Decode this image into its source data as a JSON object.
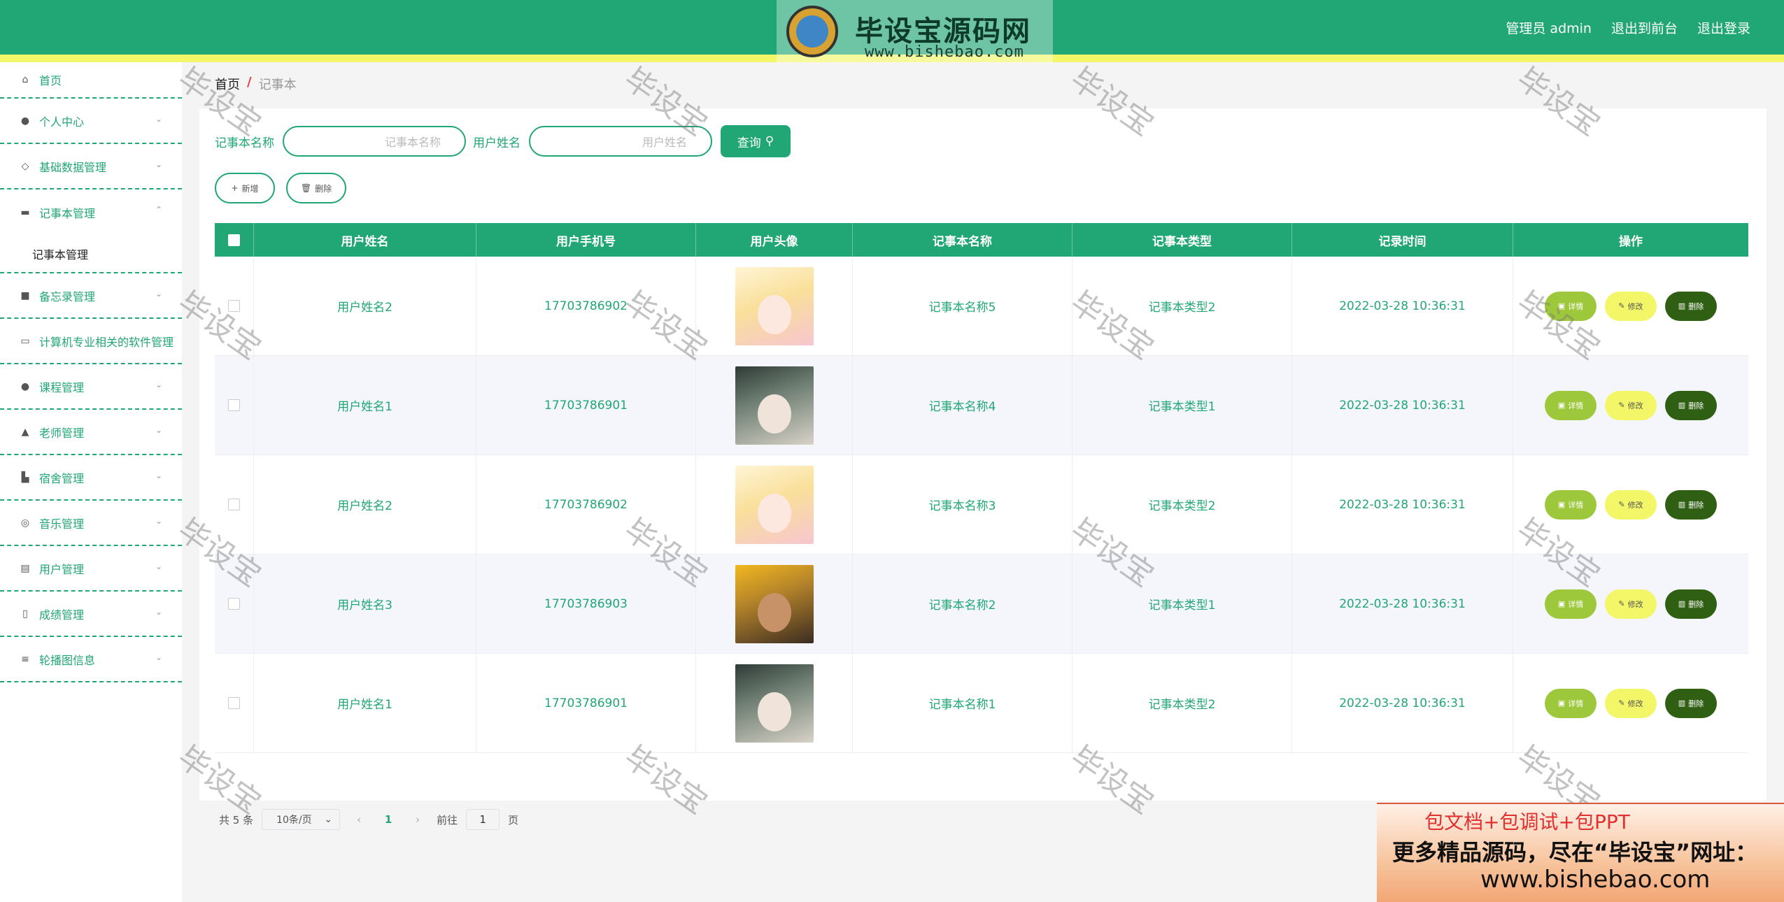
{
  "header": {
    "logo_brand": "毕设宝源码网",
    "logo_url": "www.bishebao.com",
    "admin_label": "管理员 admin",
    "front_label": "退出到前台",
    "logout_label": "退出登录"
  },
  "sidebar": {
    "items": [
      {
        "label": "首页",
        "icon": "home-icon"
      },
      {
        "label": "个人中心",
        "icon": "user-icon"
      },
      {
        "label": "基础数据管理",
        "icon": "bell-off-icon"
      },
      {
        "label": "记事本管理",
        "icon": "monitor-icon"
      },
      {
        "label": "备忘录管理",
        "icon": "check-square-icon"
      },
      {
        "label": "计算机专业相关的软件管理",
        "icon": "chat-icon"
      },
      {
        "label": "课程管理",
        "icon": "user-icon"
      },
      {
        "label": "老师管理",
        "icon": "teacher-icon"
      },
      {
        "label": "宿舍管理",
        "icon": "dorm-icon"
      },
      {
        "label": "音乐管理",
        "icon": "compass-icon"
      },
      {
        "label": "用户管理",
        "icon": "clipboard-icon"
      },
      {
        "label": "成绩管理",
        "icon": "mic-icon"
      },
      {
        "label": "轮播图信息",
        "icon": "sliders-icon"
      }
    ],
    "sub_item": "记事本管理"
  },
  "breadcrumb": {
    "home": "首页",
    "sep": "/",
    "current": "记事本"
  },
  "search": {
    "label1": "记事本名称",
    "placeholder1": "记事本名称",
    "label2": "用户姓名",
    "placeholder2": "用户姓名",
    "query_label": "查询"
  },
  "actions": {
    "add_label": "新增",
    "delete_label": "删除"
  },
  "table": {
    "columns": [
      "用户姓名",
      "用户手机号",
      "用户头像",
      "记事本名称",
      "记事本类型",
      "记录时间",
      "操作"
    ],
    "rows": [
      {
        "name": "用户姓名2",
        "phone": "17703786902",
        "avatar": "blonde",
        "notebook": "记事本名称5",
        "type": "记事本类型2",
        "time": "2022-03-28 10:36:31"
      },
      {
        "name": "用户姓名1",
        "phone": "17703786901",
        "avatar": "dark",
        "notebook": "记事本名称4",
        "type": "记事本类型1",
        "time": "2022-03-28 10:36:31"
      },
      {
        "name": "用户姓名2",
        "phone": "17703786902",
        "avatar": "blonde",
        "notebook": "记事本名称3",
        "type": "记事本类型2",
        "time": "2022-03-28 10:36:31"
      },
      {
        "name": "用户姓名3",
        "phone": "17703786903",
        "avatar": "yellow",
        "notebook": "记事本名称2",
        "type": "记事本类型1",
        "time": "2022-03-28 10:36:31"
      },
      {
        "name": "用户姓名1",
        "phone": "17703786901",
        "avatar": "dark",
        "notebook": "记事本名称1",
        "type": "记事本类型2",
        "time": "2022-03-28 10:36:31"
      }
    ],
    "op_detail": "详情",
    "op_edit": "修改",
    "op_delete": "删除"
  },
  "pager": {
    "total": "共 5 条",
    "page_size": "10条/页",
    "current_page": "1",
    "jump_prefix": "前往",
    "jump_value": "1",
    "jump_suffix": "页"
  },
  "watermark": "毕设宝",
  "promo": {
    "line1": "包文档+包调试+包PPT",
    "line2": "更多精品源码，尽在“毕设宝”网址：",
    "line3": "www.bishebao.com"
  },
  "colors": {
    "primary": "#21a675",
    "accent_yellow": "#f3f767",
    "detail_btn": "#9ec83b",
    "delete_btn": "#2f5f12"
  }
}
